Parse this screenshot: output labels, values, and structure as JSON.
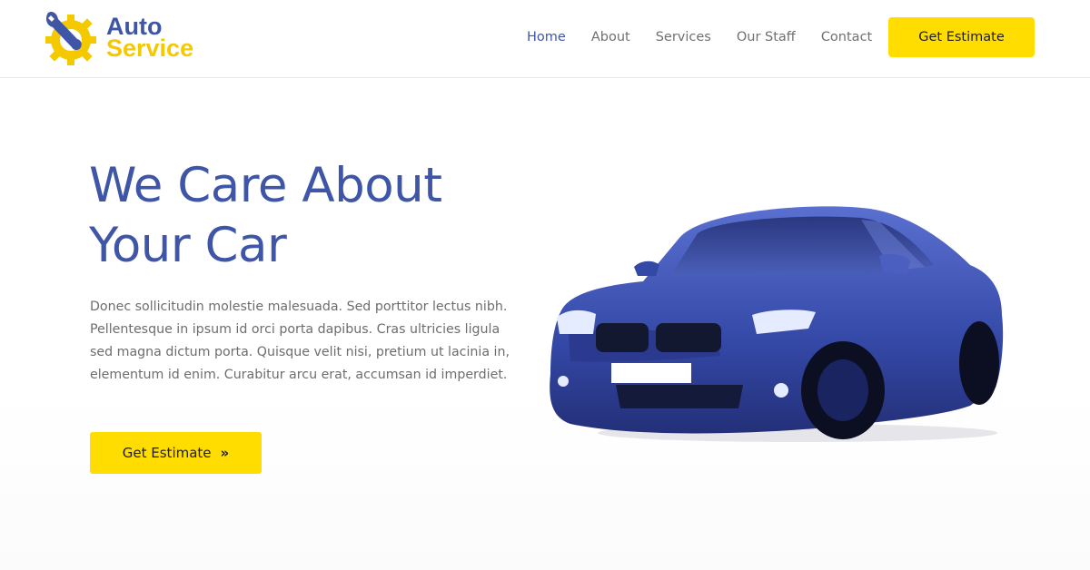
{
  "brand": {
    "line1": "Auto",
    "line2": "Service",
    "logo_icon": "wrench-gear-icon",
    "colors": {
      "primary": "#3f56a8",
      "accent": "#ffdd00"
    }
  },
  "nav": {
    "items": [
      {
        "label": "Home",
        "active": true
      },
      {
        "label": "About",
        "active": false
      },
      {
        "label": "Services",
        "active": false
      },
      {
        "label": "Our Staff",
        "active": false
      },
      {
        "label": "Contact",
        "active": false
      }
    ],
    "cta_label": "Get Estimate"
  },
  "hero": {
    "title_line1": "We Care About",
    "title_line2": "Your Car",
    "text": "Donec sollicitudin molestie malesuada. Sed porttitor lectus nibh. Pellentesque in ipsum id orci porta dapibus. Cras ultricies ligula sed magna dictum porta. Quisque velit nisi, pretium ut lacinia in, elementum id enim. Curabitur arcu erat, accumsan id imperdiet.",
    "cta_label": "Get Estimate",
    "cta_icon": "double-chevron-right-icon",
    "image": "blue-sedan-car-image"
  }
}
